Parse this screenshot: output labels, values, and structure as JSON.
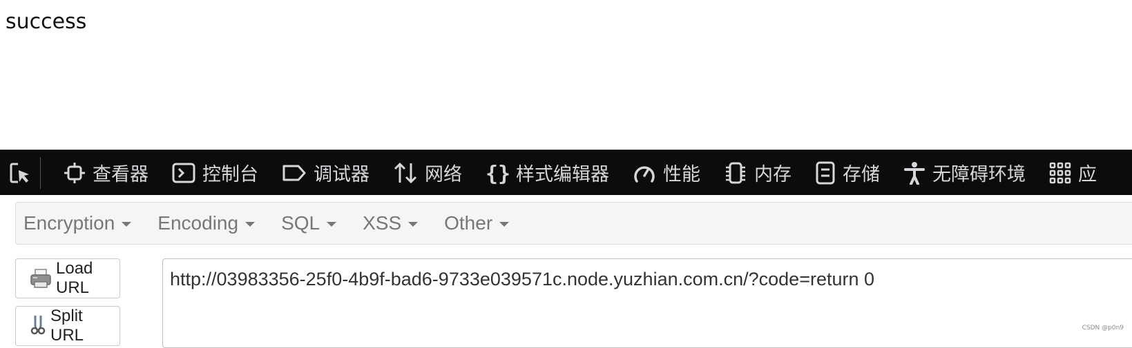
{
  "page": {
    "output_text": "success"
  },
  "devtools": {
    "picker_icon": "element-picker-icon",
    "tabs": [
      {
        "label": "查看器",
        "icon": "inspector-icon"
      },
      {
        "label": "控制台",
        "icon": "console-icon"
      },
      {
        "label": "调试器",
        "icon": "debugger-icon"
      },
      {
        "label": "网络",
        "icon": "network-icon"
      },
      {
        "label": "样式编辑器",
        "icon": "style-editor-icon"
      },
      {
        "label": "性能",
        "icon": "performance-icon"
      },
      {
        "label": "内存",
        "icon": "memory-icon"
      },
      {
        "label": "存储",
        "icon": "storage-icon"
      },
      {
        "label": "无障碍环境",
        "icon": "accessibility-icon"
      },
      {
        "label": "应",
        "icon": "application-icon"
      }
    ],
    "colors": {
      "background": "#0c0c0d",
      "text": "#d7d7db"
    }
  },
  "hackbar": {
    "menu": [
      "Encryption",
      "Encoding",
      "SQL",
      "XSS",
      "Other"
    ],
    "load_url_label": "Load URL",
    "split_url_label": "Split URL",
    "url_value": "http://03983356-25f0-4b9f-bad6-9733e039571c.node.yuzhian.com.cn/?code=return 0"
  },
  "watermark": "CSDN @p0n9"
}
